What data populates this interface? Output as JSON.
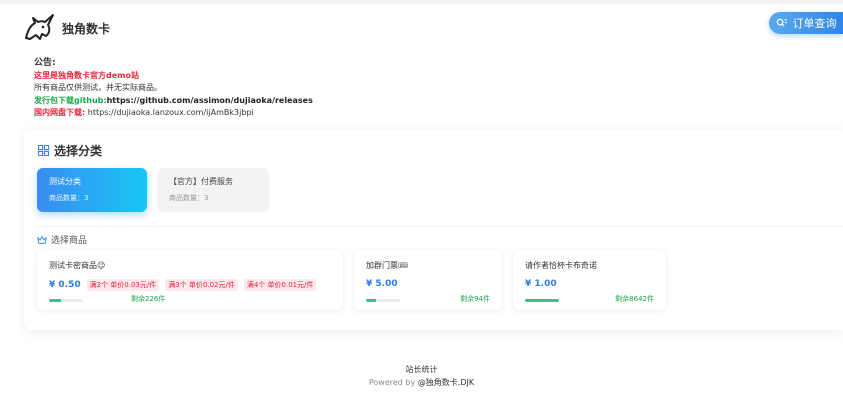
{
  "header": {
    "brand": "独角数卡",
    "order_query": "订单查询"
  },
  "notice": {
    "heading": "公告:",
    "line1": "这里是独角数卡官方demo站",
    "line2": "所有商品仅供测试，并无实际商品。",
    "line3_label": "发行包下载github:",
    "line3_url": "https://github.com/assimon/dujiaoka/releases",
    "line4_label": "国内网盘下载:",
    "line4_url": "https://dujiaoka.lanzoux.com/ijAmBk3jbpi"
  },
  "categories_section": {
    "title": "选择分类",
    "items": [
      {
        "name": "测试分类",
        "count": "商品数量：3"
      },
      {
        "name": "【官方】付费服务",
        "count": "商品数量：3"
      }
    ]
  },
  "products_section": {
    "title": "选择商品",
    "items": [
      {
        "name": "测试卡密商品😉",
        "price": "¥ 0.50",
        "wholesale": [
          "满2个 单价0.03元/件",
          "满3个 单价0.02元/件",
          "满4个 单价0.01元/件"
        ],
        "stock": "剩余226件",
        "stock_level": 0.35
      },
      {
        "name": "加群门票🎟",
        "price": "¥ 5.00",
        "wholesale": [],
        "stock": "剩余94件",
        "stock_level": 0.3
      },
      {
        "name": "请作者恰杯卡布奇诺",
        "price": "¥ 1.00",
        "wholesale": [],
        "stock": "剩余8642件",
        "stock_level": 1.0
      }
    ]
  },
  "footer": {
    "stats": "站长统计",
    "powered_prefix": "Powered by",
    "powered_by": "@独角数卡.DJK"
  },
  "colors": {
    "accent": "#2f86e6",
    "notice_red": "#e8253a",
    "notice_green": "#1aa84b",
    "stock_bar": "#36c28a"
  },
  "icons": {
    "logo": "unicorn-logo",
    "order": "search-list-icon",
    "categories": "grid-icon",
    "products": "crown-icon"
  }
}
